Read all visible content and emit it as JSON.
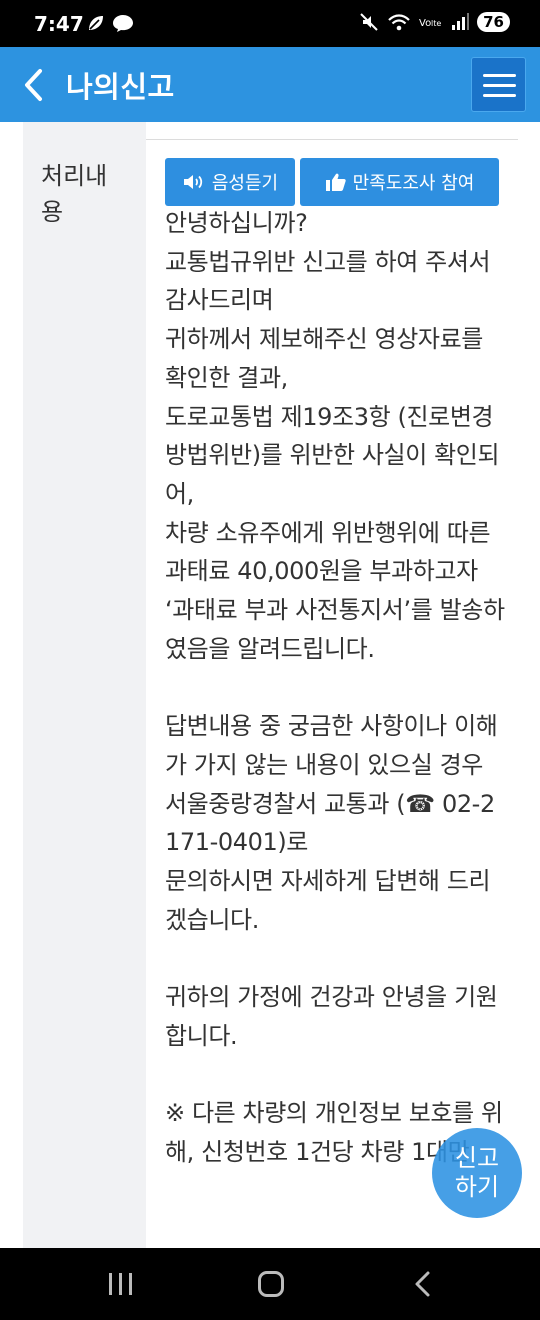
{
  "status_bar": {
    "time": "7:47",
    "battery": "76",
    "icons": [
      "leaf-icon",
      "chat-bubble-icon",
      "mute-icon",
      "wifi-icon",
      "volte-icon",
      "signal-icon"
    ]
  },
  "header": {
    "title": "나의신고",
    "background_color": "#2d93e0",
    "menu_button_color": "#1a73c9"
  },
  "detail": {
    "label": "처리내용",
    "buttons": {
      "voice": "음성듣기",
      "survey": "만족도조사 참여"
    },
    "paragraphs": [
      "안녕하십니까?",
      "교통법규위반 신고를 하여 주셔서 감사드리며",
      "귀하께서 제보해주신 영상자료를 확인한 결과,",
      "도로교통법 제19조3항 (진로변경 방법위반)를 위반한 사실이 확인되어,",
      "차량 소유주에게 위반행위에 따른 과태료 40,000원을 부과하고자",
      "‘과태료 부과 사전통지서’를 발송하였음을 알려드립니다.",
      "",
      "답변내용 중 궁금한 사항이나 이해가 가지 않는 내용이 있으실 경우",
      "서울중랑경찰서 교통과 (☎ 02-2171-0401)로",
      "문의하시면 자세하게 답변해 드리겠습니다.",
      "",
      "귀하의 가정에 건강과 안녕을 기원합니다.",
      "",
      "※ 다른 차량의 개인정보 보호를 위해, 신청번호 1건당 차량 1대만"
    ]
  },
  "fab": {
    "line1": "신고",
    "line2": "하기"
  }
}
